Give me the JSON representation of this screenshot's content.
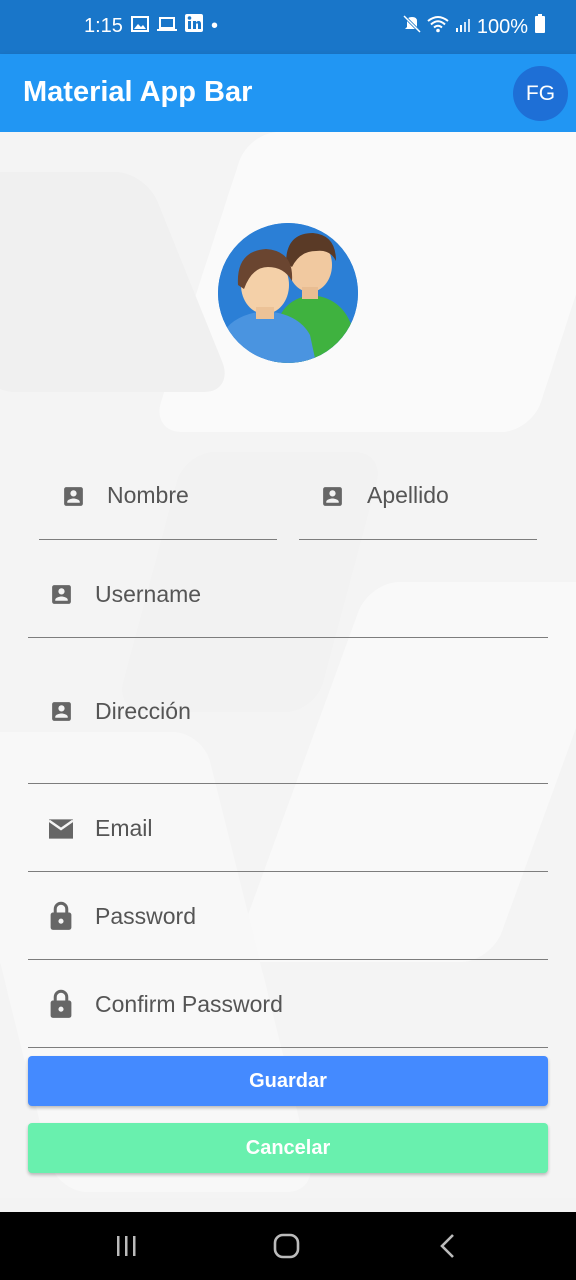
{
  "status_bar": {
    "time": "1:15",
    "dot": "•",
    "battery": "100%",
    "icons_left": [
      "gallery-icon",
      "laptop-icon",
      "linkedin-icon"
    ],
    "icons_right": [
      "mute-icon",
      "wifi-icon",
      "signal-icon",
      "battery-icon"
    ]
  },
  "app_bar": {
    "title": "Material App Bar",
    "avatar_initials": "FG"
  },
  "form": {
    "nombre_label": "Nombre",
    "apellido_label": "Apellido",
    "username_label": "Username",
    "direccion_label": "Dirección",
    "email_label": "Email",
    "password_label": "Password",
    "confirm_password_label": "Confirm Password"
  },
  "buttons": {
    "save_label": "Guardar",
    "cancel_label": "Cancelar",
    "save_color": "#448aff",
    "cancel_color": "#69f0ae"
  },
  "colors": {
    "status_bar": "#1976c9",
    "app_bar": "#2196f3",
    "avatar": "#1e6fd6"
  }
}
